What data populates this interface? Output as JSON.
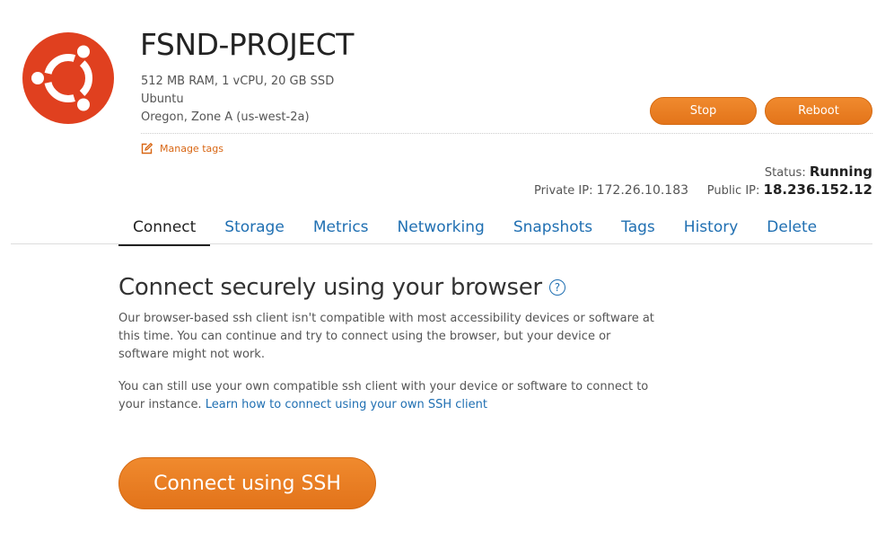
{
  "instance": {
    "name": "FSND-PROJECT",
    "specs": "512 MB RAM, 1 vCPU, 20 GB SSD",
    "os": "Ubuntu",
    "location": "Oregon, Zone A (us-west-2a)",
    "logo_icon": "ubuntu-logo",
    "logo_color": "#e0401f"
  },
  "actions": {
    "stop_label": "Stop",
    "reboot_label": "Reboot",
    "manage_tags_label": "Manage tags",
    "manage_tags_icon": "edit-icon",
    "accent_color": "#e87d22"
  },
  "status": {
    "label": "Status:",
    "value": "Running",
    "private_ip_label": "Private IP:",
    "private_ip": "172.26.10.183",
    "public_ip_label": "Public IP:",
    "public_ip": "18.236.152.12"
  },
  "tabs": [
    {
      "label": "Connect",
      "active": true
    },
    {
      "label": "Storage",
      "active": false
    },
    {
      "label": "Metrics",
      "active": false
    },
    {
      "label": "Networking",
      "active": false
    },
    {
      "label": "Snapshots",
      "active": false
    },
    {
      "label": "Tags",
      "active": false
    },
    {
      "label": "History",
      "active": false
    },
    {
      "label": "Delete",
      "active": false
    }
  ],
  "connect": {
    "heading": "Connect securely using your browser",
    "help_icon": "?",
    "paragraph1": "Our browser-based ssh client isn't compatible with most accessibility devices or software at this time. You can continue and try to connect using the browser, but your device or software might not work.",
    "paragraph2_text": "You can still use your own compatible ssh client with your device or software to connect to your instance.",
    "paragraph2_link": "Learn how to connect using your own SSH client",
    "ssh_button_label": "Connect using SSH"
  }
}
